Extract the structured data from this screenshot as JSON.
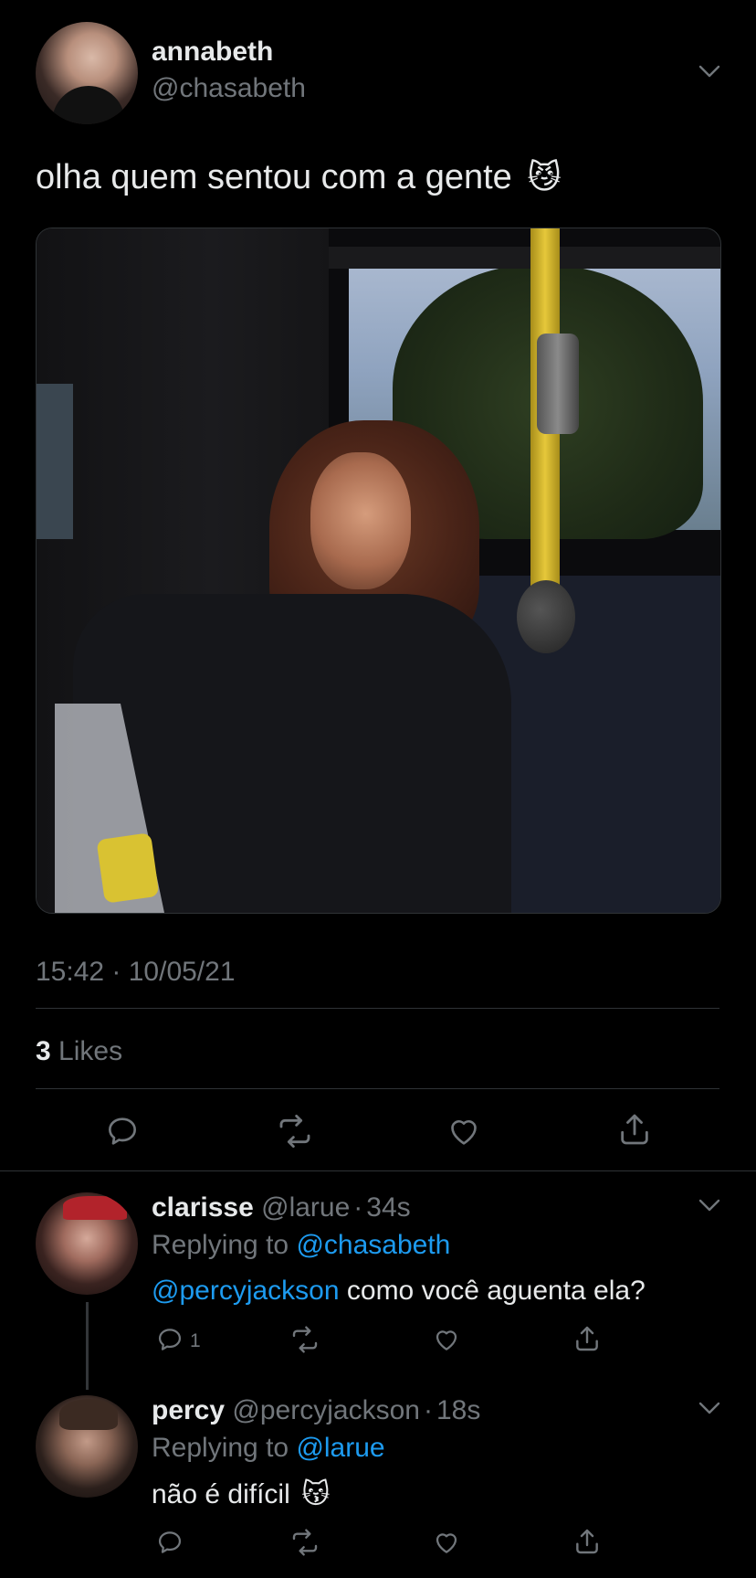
{
  "tweet": {
    "display_name": "annabeth",
    "handle": "@chasabeth",
    "text": "olha quem sentou com a gente",
    "emoji": "😼",
    "timestamp": "15:42 · 10/05/21",
    "likes_count": "3",
    "likes_label": "Likes"
  },
  "replies": [
    {
      "display_name": "clarisse",
      "handle": "@larue",
      "sep": "·",
      "time": "34s",
      "replying_prefix": "Replying to",
      "replying_to": "@chasabeth",
      "mention": "@percyjackson",
      "text": " como você aguenta ela?",
      "reply_count": "1"
    },
    {
      "display_name": "percy",
      "handle": "@percyjackson",
      "sep": "·",
      "time": "18s",
      "replying_prefix": "Replying to",
      "replying_to": "@larue",
      "text": "não é difícil",
      "emoji": "😽"
    }
  ],
  "icons": {
    "reply": "reply-icon",
    "retweet": "retweet-icon",
    "like": "heart-icon",
    "share": "share-icon",
    "more": "chevron-down-icon"
  },
  "colors": {
    "background": "#000000",
    "text": "#e7e9ea",
    "muted": "#71767b",
    "link": "#1d9bf0",
    "divider": "#2f3336"
  }
}
